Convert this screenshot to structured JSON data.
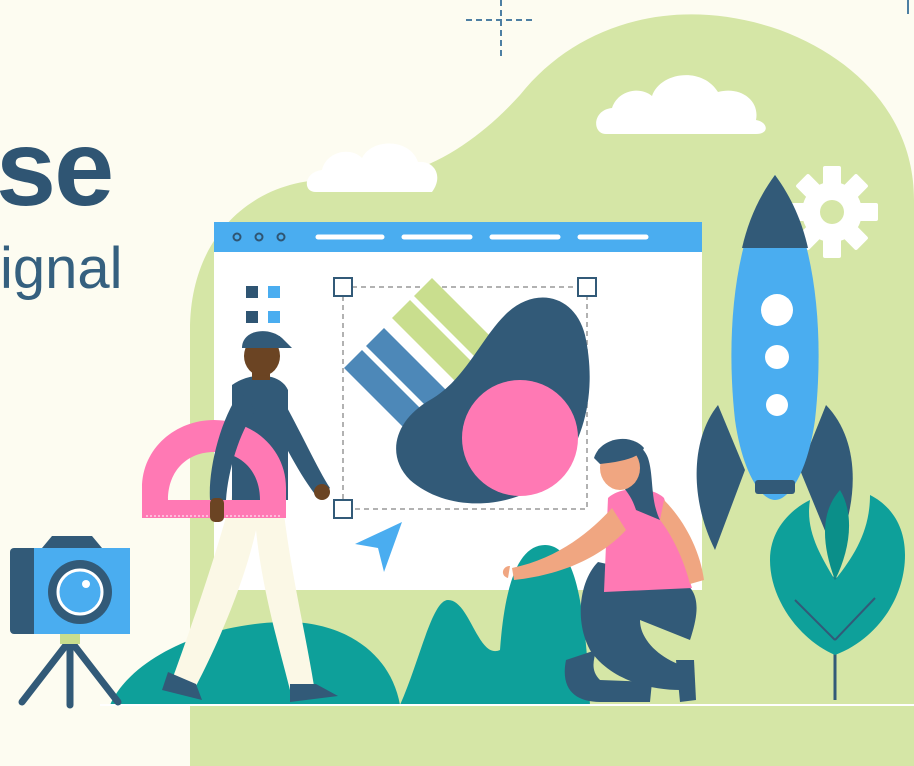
{
  "headline": {
    "heading_fragment": "se",
    "subheading_fragment": "ignal"
  },
  "palette": {
    "background": "#fdfcf1",
    "blob_green": "#d5e6a6",
    "navy": "#325a78",
    "sky_blue": "#4aadf0",
    "pink": "#ff79b4",
    "teal": "#0ea09a",
    "stripe_blue": "#4d88b8",
    "stripe_green": "#c9de8e",
    "cloud": "#ffffff"
  },
  "icons": {
    "browser_dots": "three-dots-icon",
    "gear": "gear-icon",
    "cursor": "arrow-cursor-icon",
    "camera": "camera-icon",
    "rocket": "rocket-icon",
    "protractor": "protractor-icon"
  }
}
